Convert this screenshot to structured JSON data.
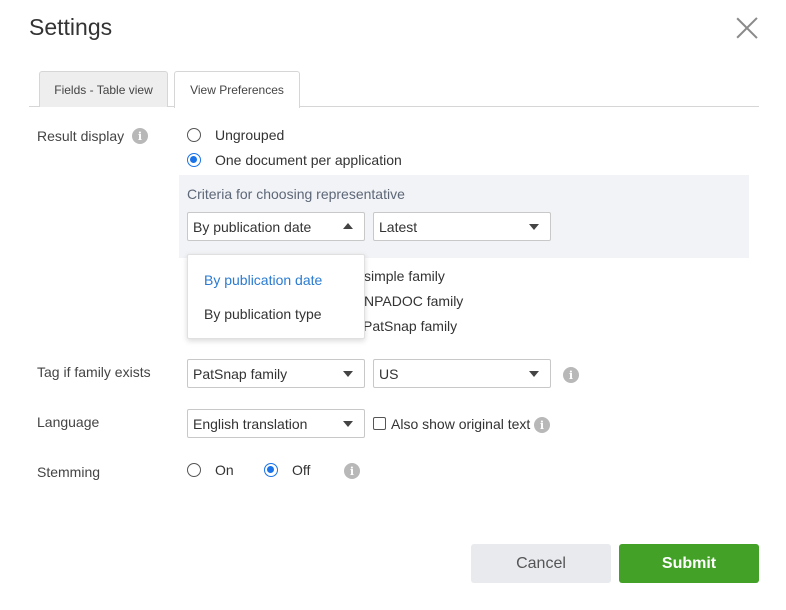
{
  "dialog": {
    "title": "Settings"
  },
  "tabs": [
    {
      "label": "Fields - Table view",
      "active": false
    },
    {
      "label": "View Preferences",
      "active": true
    }
  ],
  "result_display": {
    "label": "Result display",
    "options": [
      {
        "label": "Ungrouped",
        "checked": false
      },
      {
        "label": "One document per application",
        "checked": true
      }
    ],
    "criteria": {
      "label": "Criteria for choosing representative",
      "sort_by": "By publication date",
      "order": "Latest",
      "dropdown_open": true,
      "dropdown_options": [
        "By publication date",
        "By publication type"
      ]
    },
    "family_options_partial": [
      "simple family",
      "NPADOC family",
      "PatSnap family"
    ]
  },
  "tag_if_family": {
    "label": "Tag if family exists",
    "family_value": "PatSnap family",
    "country_value": "US"
  },
  "language": {
    "label": "Language",
    "value": "English translation",
    "also_show_original_label": "Also show original text",
    "also_show_original_checked": false
  },
  "stemming": {
    "label": "Stemming",
    "options": [
      {
        "label": "On",
        "checked": false
      },
      {
        "label": "Off",
        "checked": true
      }
    ]
  },
  "footer": {
    "cancel_label": "Cancel",
    "submit_label": "Submit"
  },
  "colors": {
    "accent": "#1a73e8",
    "submit": "#42a126",
    "criteria_bg": "#f1f3f6"
  }
}
